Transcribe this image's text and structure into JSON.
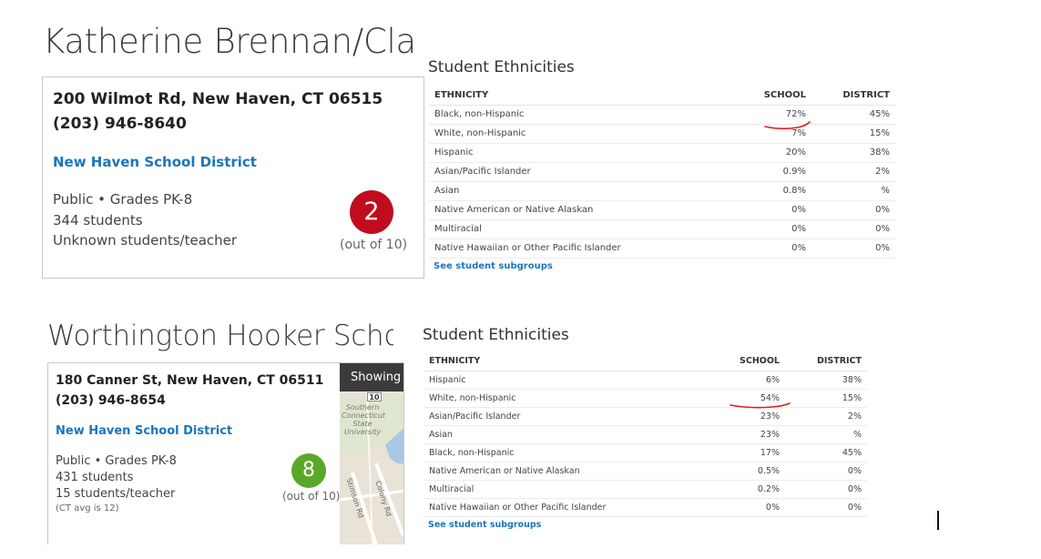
{
  "schools": [
    {
      "title": "Katherine Brennan/Clarer",
      "address": "200 Wilmot Rd, New Haven, CT 06515",
      "phone": "(203) 946-8640",
      "district": "New Haven School District",
      "type_grades": "Public • Grades PK-8",
      "students": "344 students",
      "ratio": "Unknown students/teacher",
      "rating": "2",
      "rating_out_of": "(out of 10)",
      "rating_color": "#c00d1e",
      "ethnicities": {
        "title": "Student Ethnicities",
        "headers": {
          "ethnicity": "ETHNICITY",
          "school": "SCHOOL",
          "district": "DISTRICT"
        },
        "rows": [
          {
            "ethnicity": "Black, non-Hispanic",
            "school": "72%",
            "district": "45%"
          },
          {
            "ethnicity": "White, non-Hispanic",
            "school": "7%",
            "district": "15%"
          },
          {
            "ethnicity": "Hispanic",
            "school": "20%",
            "district": "38%"
          },
          {
            "ethnicity": "Asian/Pacific Islander",
            "school": "0.9%",
            "district": "2%"
          },
          {
            "ethnicity": "Asian",
            "school": "0.8%",
            "district": "%"
          },
          {
            "ethnicity": "Native American or Native Alaskan",
            "school": "0%",
            "district": "0%"
          },
          {
            "ethnicity": "Multiracial",
            "school": "0%",
            "district": "0%"
          },
          {
            "ethnicity": "Native Hawaiian or Other Pacific Islander",
            "school": "0%",
            "district": "0%"
          }
        ],
        "subgroups_link": "See student subgroups"
      }
    },
    {
      "title": "Worthington Hooker School",
      "address": "180 Canner St, New Haven, CT 06511",
      "phone": "(203) 946-8654",
      "district": "New Haven School District",
      "type_grades": "Public • Grades PK-8",
      "students": "431 students",
      "ratio": "15 students/teacher",
      "ratio_note": "(CT avg is 12)",
      "rating": "8",
      "rating_out_of": "(out of 10)",
      "rating_color": "#5ba829",
      "map": {
        "banner": "Showing sc",
        "shield": "10",
        "place_label": "Southern\nConnecticut\nState\nUniversity",
        "roads": [
          "Stimson Rd",
          "Colony Rd"
        ]
      },
      "ethnicities": {
        "title": "Student Ethnicities",
        "headers": {
          "ethnicity": "ETHNICITY",
          "school": "SCHOOL",
          "district": "DISTRICT"
        },
        "rows": [
          {
            "ethnicity": "Hispanic",
            "school": "6%",
            "district": "38%"
          },
          {
            "ethnicity": "White, non-Hispanic",
            "school": "54%",
            "district": "15%"
          },
          {
            "ethnicity": "Asian/Pacific Islander",
            "school": "23%",
            "district": "2%"
          },
          {
            "ethnicity": "Asian",
            "school": "23%",
            "district": "%"
          },
          {
            "ethnicity": "Black, non-Hispanic",
            "school": "17%",
            "district": "45%"
          },
          {
            "ethnicity": "Native American or Native Alaskan",
            "school": "0.5%",
            "district": "0%"
          },
          {
            "ethnicity": "Multiracial",
            "school": "0.2%",
            "district": "0%"
          },
          {
            "ethnicity": "Native Hawaiian or Other Pacific Islander",
            "school": "0%",
            "district": "0%"
          }
        ],
        "subgroups_link": "See student subgroups"
      }
    }
  ],
  "annotation_color": "#e8191f"
}
